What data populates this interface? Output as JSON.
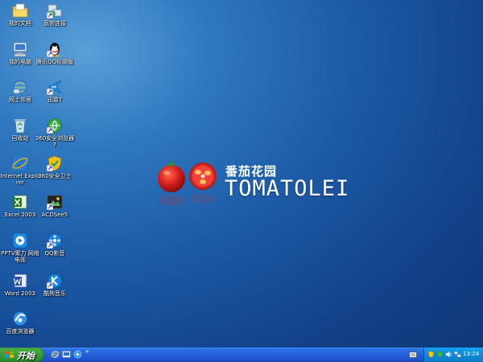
{
  "desktop": {
    "icons": [
      {
        "label": "我的文档",
        "icon": "my-documents-icon"
      },
      {
        "label": "宽带连接",
        "icon": "broadband-connection-icon"
      },
      {
        "label": "我的电脑",
        "icon": "my-computer-icon"
      },
      {
        "label": "腾讯QQ轻聊版",
        "icon": "qq-icon"
      },
      {
        "label": "网上邻居",
        "icon": "network-places-icon"
      },
      {
        "label": "迅雷7",
        "icon": "thunder-icon"
      },
      {
        "label": "回收站",
        "icon": "recycle-bin-icon"
      },
      {
        "label": "360安全浏览器7",
        "icon": "360-browser-icon"
      },
      {
        "label": "Internet Explorer",
        "icon": "ie-icon"
      },
      {
        "label": "360安全卫士",
        "icon": "360-guard-icon"
      },
      {
        "label": "Excel 2003",
        "icon": "excel-icon"
      },
      {
        "label": "ACDSee5",
        "icon": "acdsee-icon"
      },
      {
        "label": "PPTV聚力 网络电视",
        "icon": "pptv-icon"
      },
      {
        "label": "QQ影音",
        "icon": "qq-player-icon"
      },
      {
        "label": "Word 2003",
        "icon": "word-icon"
      },
      {
        "label": "酷狗音乐",
        "icon": "kugou-icon"
      },
      {
        "label": "百度浏览器",
        "icon": "baidu-browser-icon"
      }
    ]
  },
  "wallpaper": {
    "logo_cn": "番茄花园",
    "logo_en": "TOMATOLEI"
  },
  "taskbar": {
    "start_label": "开始",
    "quick_launch_more": "»",
    "clock": "13:24"
  },
  "colors": {
    "desktop_blue": "#1c5aa6",
    "taskbar_blue": "#245edb",
    "start_green": "#3a9f3a",
    "tray_blue": "#0e8ad9",
    "tomato_red": "#d8201e"
  }
}
